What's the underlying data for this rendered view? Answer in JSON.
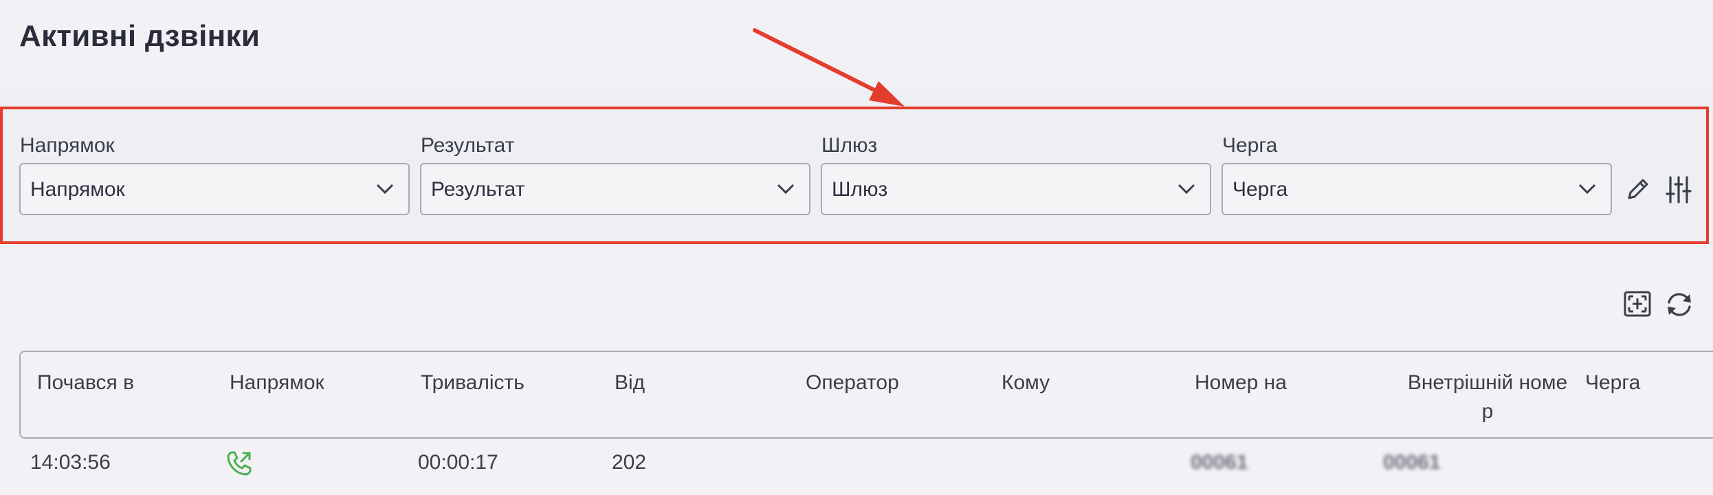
{
  "page": {
    "title": "Активні дзвінки"
  },
  "filters": [
    {
      "label": "Напрямок",
      "value": "Напрямок"
    },
    {
      "label": "Результат",
      "value": "Результат"
    },
    {
      "label": "Шлюз",
      "value": "Шлюз"
    },
    {
      "label": "Черга",
      "value": "Черга"
    }
  ],
  "toolbar": {
    "edit_icon": "pencil-icon",
    "settings_icon": "sliders-icon",
    "fullscreen_icon": "fullscreen-icon",
    "refresh_icon": "refresh-icon"
  },
  "table": {
    "columns": [
      "Почався в",
      "Напрямок",
      "Тривалість",
      "Від",
      "Оператор",
      "Кому",
      "Номер на",
      "Внетрішній номе\nр",
      "Черга"
    ],
    "rows": [
      {
        "started": "14:03:56",
        "direction_icon": "outgoing-call-icon",
        "duration": "00:00:17",
        "from": "202",
        "operator": "",
        "to": "",
        "number_on": "00061",
        "internal_number": "00061",
        "queue": ""
      }
    ]
  },
  "colors": {
    "highlight": "#e33d2e",
    "call_icon": "#4caf50",
    "background": "#f2f2f6"
  }
}
